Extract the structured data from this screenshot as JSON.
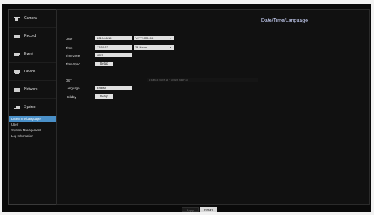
{
  "sidebar": {
    "items": [
      {
        "label": "Camera",
        "icon": "camera-icon"
      },
      {
        "label": "Record",
        "icon": "record-icon"
      },
      {
        "label": "Event",
        "icon": "event-icon"
      },
      {
        "label": "Device",
        "icon": "device-icon"
      },
      {
        "label": "Network",
        "icon": "network-icon"
      },
      {
        "label": "System",
        "icon": "system-icon"
      }
    ],
    "subitems": [
      {
        "label": "Date/Time/Language",
        "active": true
      },
      {
        "label": "User",
        "active": false
      },
      {
        "label": "System Management",
        "active": false
      },
      {
        "label": "Log Information",
        "active": false
      }
    ]
  },
  "main": {
    "title": "Date/Time/Language",
    "fields": {
      "date_label": "Date",
      "date_value": "2019-06-15",
      "date_format": "YYYY-MM-DD",
      "time_label": "Time",
      "time_value": "17:54:22",
      "time_format": "24 Hours",
      "time_zone_label": "Time zone",
      "time_zone_value": "GMT",
      "time_sync_label": "Time Sync",
      "time_sync_button": "Setup",
      "dst_label": "DST",
      "dst_text": "a   Mar     1st     Sun/F 18     ~     Oct     1st     Sun/F 18",
      "language_label": "Language",
      "language_value": "English",
      "holiday_label": "Holiday",
      "holiday_button": "Setup"
    },
    "footer": {
      "apply": "Apply",
      "return": "Return"
    }
  },
  "colors": {
    "accent": "#4a90c8",
    "title": "#cfd8ff"
  }
}
